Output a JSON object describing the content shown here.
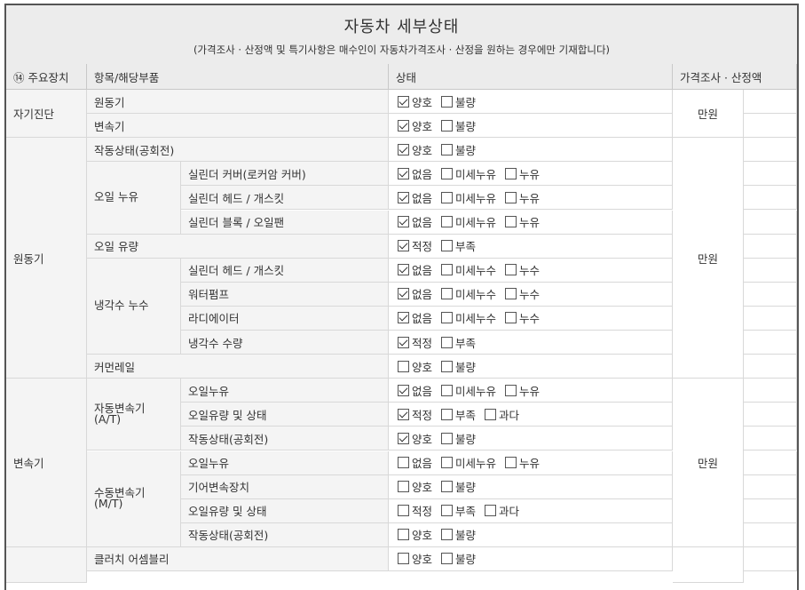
{
  "header": {
    "title": "자동차 세부상태",
    "subtitle": "(가격조사 · 산정액 및 특기사항은 매수인이 자동차가격조사 · 산정을 원하는 경우에만 기재합니다)"
  },
  "columns": {
    "main": "⑭ 주요장치",
    "item": "항목/해당부품",
    "status": "상태",
    "price": "가격조사 · 산정액"
  },
  "unit": "만원",
  "groups": {
    "self_diag": "자기진단",
    "engine": "원동기",
    "transmission": "변속기"
  },
  "subgroups": {
    "oil_leak": "오일 누유",
    "coolant_leak": "냉각수 누수",
    "auto_trans": "자동변속기 (A/T)",
    "manual_trans": "수동변속기 (M/T)"
  },
  "rows": [
    {
      "label": "원동기",
      "options": [
        {
          "text": "양호",
          "checked": true
        },
        {
          "text": "불량",
          "checked": false
        }
      ]
    },
    {
      "label": "변속기",
      "options": [
        {
          "text": "양호",
          "checked": true
        },
        {
          "text": "불량",
          "checked": false
        }
      ]
    },
    {
      "label": "작동상태(공회전)",
      "options": [
        {
          "text": "양호",
          "checked": true
        },
        {
          "text": "불량",
          "checked": false
        }
      ]
    },
    {
      "label": "실린더 커버(로커암 커버)",
      "options": [
        {
          "text": "없음",
          "checked": true
        },
        {
          "text": "미세누유",
          "checked": false
        },
        {
          "text": "누유",
          "checked": false
        }
      ]
    },
    {
      "label": "실린더 헤드 / 개스킷",
      "options": [
        {
          "text": "없음",
          "checked": true
        },
        {
          "text": "미세누유",
          "checked": false
        },
        {
          "text": "누유",
          "checked": false
        }
      ]
    },
    {
      "label": "실린더 블록 / 오일팬",
      "options": [
        {
          "text": "없음",
          "checked": true
        },
        {
          "text": "미세누유",
          "checked": false
        },
        {
          "text": "누유",
          "checked": false
        }
      ]
    },
    {
      "label": "오일 유량",
      "options": [
        {
          "text": "적정",
          "checked": true
        },
        {
          "text": "부족",
          "checked": false
        }
      ]
    },
    {
      "label": "실린더 헤드 / 개스킷",
      "options": [
        {
          "text": "없음",
          "checked": true
        },
        {
          "text": "미세누수",
          "checked": false
        },
        {
          "text": "누수",
          "checked": false
        }
      ]
    },
    {
      "label": "워터펌프",
      "options": [
        {
          "text": "없음",
          "checked": true
        },
        {
          "text": "미세누수",
          "checked": false
        },
        {
          "text": "누수",
          "checked": false
        }
      ]
    },
    {
      "label": "라디에이터",
      "options": [
        {
          "text": "없음",
          "checked": true
        },
        {
          "text": "미세누수",
          "checked": false
        },
        {
          "text": "누수",
          "checked": false
        }
      ]
    },
    {
      "label": "냉각수 수량",
      "options": [
        {
          "text": "적정",
          "checked": true
        },
        {
          "text": "부족",
          "checked": false
        }
      ]
    },
    {
      "label": "커먼레일",
      "options": [
        {
          "text": "양호",
          "checked": false
        },
        {
          "text": "불량",
          "checked": false
        }
      ]
    },
    {
      "label": "오일누유",
      "options": [
        {
          "text": "없음",
          "checked": true
        },
        {
          "text": "미세누유",
          "checked": false
        },
        {
          "text": "누유",
          "checked": false
        }
      ]
    },
    {
      "label": "오일유량 및 상태",
      "options": [
        {
          "text": "적정",
          "checked": true
        },
        {
          "text": "부족",
          "checked": false
        },
        {
          "text": "과다",
          "checked": false
        }
      ]
    },
    {
      "label": "작동상태(공회전)",
      "options": [
        {
          "text": "양호",
          "checked": true
        },
        {
          "text": "불량",
          "checked": false
        }
      ]
    },
    {
      "label": "오일누유",
      "options": [
        {
          "text": "없음",
          "checked": false
        },
        {
          "text": "미세누유",
          "checked": false
        },
        {
          "text": "누유",
          "checked": false
        }
      ]
    },
    {
      "label": "기어변속장치",
      "options": [
        {
          "text": "양호",
          "checked": false
        },
        {
          "text": "불량",
          "checked": false
        }
      ]
    },
    {
      "label": "오일유량 및 상태",
      "options": [
        {
          "text": "적정",
          "checked": false
        },
        {
          "text": "부족",
          "checked": false
        },
        {
          "text": "과다",
          "checked": false
        }
      ]
    },
    {
      "label": "작동상태(공회전)",
      "options": [
        {
          "text": "양호",
          "checked": false
        },
        {
          "text": "불량",
          "checked": false
        }
      ]
    },
    {
      "label": "클러치 어셈블리",
      "options": [
        {
          "text": "양호",
          "checked": false
        },
        {
          "text": "불량",
          "checked": false
        }
      ]
    }
  ]
}
